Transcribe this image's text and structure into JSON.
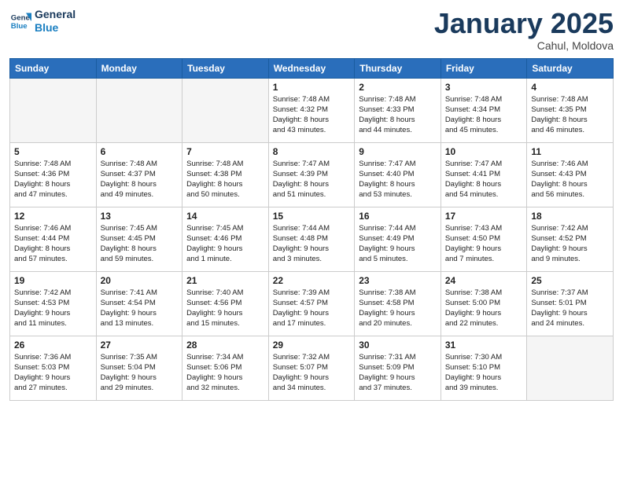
{
  "header": {
    "logo_line1": "General",
    "logo_line2": "Blue",
    "month_title": "January 2025",
    "location": "Cahul, Moldova"
  },
  "weekdays": [
    "Sunday",
    "Monday",
    "Tuesday",
    "Wednesday",
    "Thursday",
    "Friday",
    "Saturday"
  ],
  "weeks": [
    [
      {
        "day": "",
        "info": ""
      },
      {
        "day": "",
        "info": ""
      },
      {
        "day": "",
        "info": ""
      },
      {
        "day": "1",
        "info": "Sunrise: 7:48 AM\nSunset: 4:32 PM\nDaylight: 8 hours\nand 43 minutes."
      },
      {
        "day": "2",
        "info": "Sunrise: 7:48 AM\nSunset: 4:33 PM\nDaylight: 8 hours\nand 44 minutes."
      },
      {
        "day": "3",
        "info": "Sunrise: 7:48 AM\nSunset: 4:34 PM\nDaylight: 8 hours\nand 45 minutes."
      },
      {
        "day": "4",
        "info": "Sunrise: 7:48 AM\nSunset: 4:35 PM\nDaylight: 8 hours\nand 46 minutes."
      }
    ],
    [
      {
        "day": "5",
        "info": "Sunrise: 7:48 AM\nSunset: 4:36 PM\nDaylight: 8 hours\nand 47 minutes."
      },
      {
        "day": "6",
        "info": "Sunrise: 7:48 AM\nSunset: 4:37 PM\nDaylight: 8 hours\nand 49 minutes."
      },
      {
        "day": "7",
        "info": "Sunrise: 7:48 AM\nSunset: 4:38 PM\nDaylight: 8 hours\nand 50 minutes."
      },
      {
        "day": "8",
        "info": "Sunrise: 7:47 AM\nSunset: 4:39 PM\nDaylight: 8 hours\nand 51 minutes."
      },
      {
        "day": "9",
        "info": "Sunrise: 7:47 AM\nSunset: 4:40 PM\nDaylight: 8 hours\nand 53 minutes."
      },
      {
        "day": "10",
        "info": "Sunrise: 7:47 AM\nSunset: 4:41 PM\nDaylight: 8 hours\nand 54 minutes."
      },
      {
        "day": "11",
        "info": "Sunrise: 7:46 AM\nSunset: 4:43 PM\nDaylight: 8 hours\nand 56 minutes."
      }
    ],
    [
      {
        "day": "12",
        "info": "Sunrise: 7:46 AM\nSunset: 4:44 PM\nDaylight: 8 hours\nand 57 minutes."
      },
      {
        "day": "13",
        "info": "Sunrise: 7:45 AM\nSunset: 4:45 PM\nDaylight: 8 hours\nand 59 minutes."
      },
      {
        "day": "14",
        "info": "Sunrise: 7:45 AM\nSunset: 4:46 PM\nDaylight: 9 hours\nand 1 minute."
      },
      {
        "day": "15",
        "info": "Sunrise: 7:44 AM\nSunset: 4:48 PM\nDaylight: 9 hours\nand 3 minutes."
      },
      {
        "day": "16",
        "info": "Sunrise: 7:44 AM\nSunset: 4:49 PM\nDaylight: 9 hours\nand 5 minutes."
      },
      {
        "day": "17",
        "info": "Sunrise: 7:43 AM\nSunset: 4:50 PM\nDaylight: 9 hours\nand 7 minutes."
      },
      {
        "day": "18",
        "info": "Sunrise: 7:42 AM\nSunset: 4:52 PM\nDaylight: 9 hours\nand 9 minutes."
      }
    ],
    [
      {
        "day": "19",
        "info": "Sunrise: 7:42 AM\nSunset: 4:53 PM\nDaylight: 9 hours\nand 11 minutes."
      },
      {
        "day": "20",
        "info": "Sunrise: 7:41 AM\nSunset: 4:54 PM\nDaylight: 9 hours\nand 13 minutes."
      },
      {
        "day": "21",
        "info": "Sunrise: 7:40 AM\nSunset: 4:56 PM\nDaylight: 9 hours\nand 15 minutes."
      },
      {
        "day": "22",
        "info": "Sunrise: 7:39 AM\nSunset: 4:57 PM\nDaylight: 9 hours\nand 17 minutes."
      },
      {
        "day": "23",
        "info": "Sunrise: 7:38 AM\nSunset: 4:58 PM\nDaylight: 9 hours\nand 20 minutes."
      },
      {
        "day": "24",
        "info": "Sunrise: 7:38 AM\nSunset: 5:00 PM\nDaylight: 9 hours\nand 22 minutes."
      },
      {
        "day": "25",
        "info": "Sunrise: 7:37 AM\nSunset: 5:01 PM\nDaylight: 9 hours\nand 24 minutes."
      }
    ],
    [
      {
        "day": "26",
        "info": "Sunrise: 7:36 AM\nSunset: 5:03 PM\nDaylight: 9 hours\nand 27 minutes."
      },
      {
        "day": "27",
        "info": "Sunrise: 7:35 AM\nSunset: 5:04 PM\nDaylight: 9 hours\nand 29 minutes."
      },
      {
        "day": "28",
        "info": "Sunrise: 7:34 AM\nSunset: 5:06 PM\nDaylight: 9 hours\nand 32 minutes."
      },
      {
        "day": "29",
        "info": "Sunrise: 7:32 AM\nSunset: 5:07 PM\nDaylight: 9 hours\nand 34 minutes."
      },
      {
        "day": "30",
        "info": "Sunrise: 7:31 AM\nSunset: 5:09 PM\nDaylight: 9 hours\nand 37 minutes."
      },
      {
        "day": "31",
        "info": "Sunrise: 7:30 AM\nSunset: 5:10 PM\nDaylight: 9 hours\nand 39 minutes."
      },
      {
        "day": "",
        "info": ""
      }
    ]
  ]
}
